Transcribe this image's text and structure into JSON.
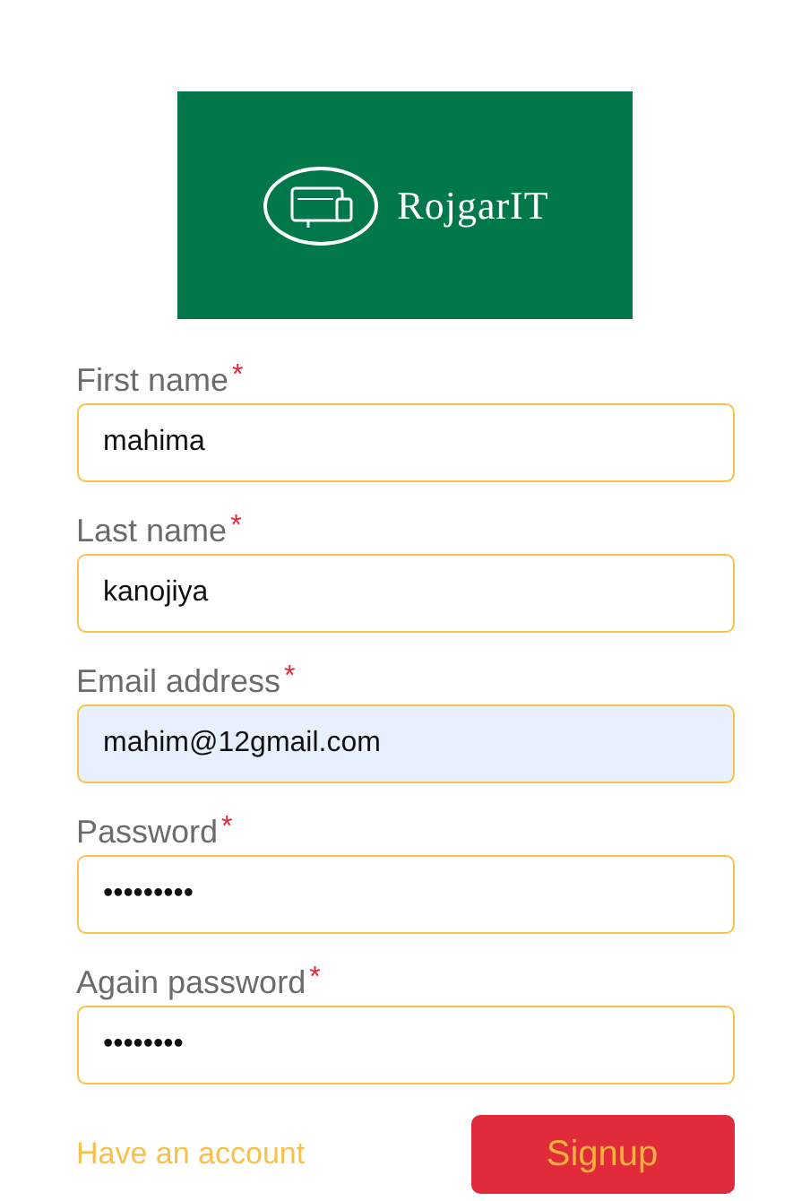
{
  "logo": {
    "text": "RojgarIT"
  },
  "fields": [
    {
      "label": "First name",
      "required_mark": "*",
      "value": "mahima",
      "autofilled": false
    },
    {
      "label": "Last name",
      "required_mark": "*",
      "value": "kanojiya",
      "autofilled": false
    },
    {
      "label": "Email address",
      "required_mark": "*",
      "value": "mahim@12gmail.com",
      "autofilled": true
    },
    {
      "label": "Password",
      "required_mark": "*",
      "value": "•••••••••",
      "autofilled": false
    },
    {
      "label": "Again password",
      "required_mark": "*",
      "value": "••••••••",
      "autofilled": false
    }
  ],
  "login_link": "Have an account",
  "submit_button": "Signup"
}
